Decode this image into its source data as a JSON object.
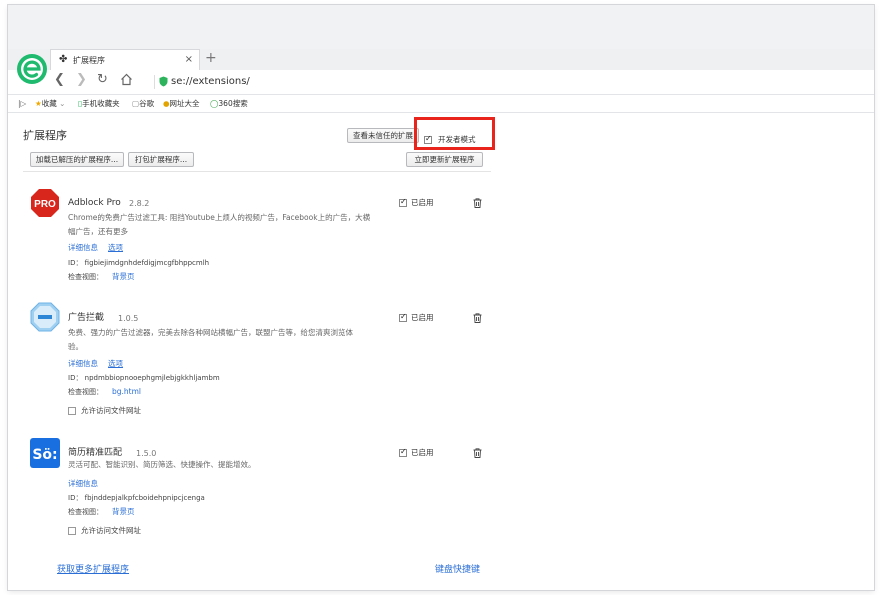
{
  "browser": {
    "tab_title": "扩展程序",
    "tab_close": "×",
    "new_tab": "+",
    "url": "se://extensions/",
    "bookmarks": [
      {
        "label": "收藏",
        "icon": "star-icon"
      },
      {
        "label": "手机收藏夹",
        "icon": "phone-icon"
      },
      {
        "label": "谷歌",
        "icon": "page-icon"
      },
      {
        "label": "网址大全",
        "icon": "site-nav-icon"
      },
      {
        "label": "360搜索",
        "icon": "search-360-icon"
      }
    ]
  },
  "page": {
    "title": "扩展程序",
    "view_untrusted": "查看未信任的扩展",
    "dev_mode": "开发者模式",
    "dev_mode_checked": true,
    "load_unpacked": "加载已解压的扩展程序...",
    "pack_extension": "打包扩展程序...",
    "update_now": "立即更新扩展程序",
    "get_more": "获取更多扩展程序",
    "keyboard_shortcuts": "键盘快捷键"
  },
  "extensions": [
    {
      "name": "Adblock Pro",
      "version": "2.8.2",
      "description_line1": "Chrome的免费广告过滤工具: 阻挡Youtube上烦人的视频广告，Facebook上的广告，大横",
      "description_line2": "幅广告，还有更多",
      "details": "详细信息",
      "options": "选项",
      "id_text": "ID： figbiejimdgnhdefdigjmcgfbhppcmlh",
      "inspect_label": "检查视图：",
      "inspect_link": "背景页",
      "enabled_label": "已启用",
      "enabled": true,
      "icon_text": "PRO",
      "icon_color": "#d9261c"
    },
    {
      "name": "广告拦截",
      "version": "1.0.5",
      "description_line1": "免费、强力的广告过滤器，完美去除各种网站横幅广告，联盟广告等，给您清爽浏览体",
      "description_line2": "验。",
      "details": "详细信息",
      "options": "选项",
      "id_text": "ID： npdmbbiopnooephgmjlebjgkkhljambm",
      "inspect_label": "检查视图：",
      "inspect_link": "bg.html",
      "enabled_label": "已启用",
      "enabled": true,
      "allow_file_access": "允许访问文件网址",
      "icon_color": "#9fd0f2"
    },
    {
      "name": "简历精准匹配",
      "version": "1.5.0",
      "description_line1": "灵活可配、智能识别、简历筛选、快捷操作、提能增效。",
      "details": "详细信息",
      "id_text": "ID： fbjnddepjalkpfcboidehpnipcjcenga",
      "inspect_label": "检查视图：",
      "inspect_link": "背景页",
      "enabled_label": "已启用",
      "enabled": true,
      "allow_file_access": "允许访问文件网址",
      "icon_text": "Sö:",
      "icon_color": "#1a6fe0"
    }
  ],
  "colors": {
    "link": "#2b6fd6",
    "highlight": "#e8241d",
    "logo": "#1fba6e"
  }
}
